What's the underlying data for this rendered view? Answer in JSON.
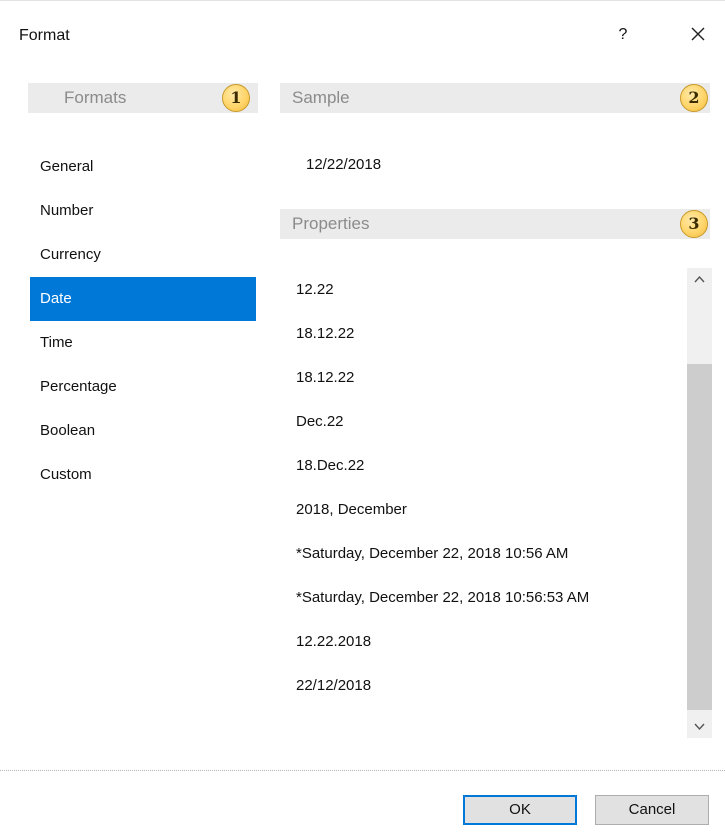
{
  "dialog": {
    "title": "Format",
    "help_label": "?",
    "close_icon": "close-icon"
  },
  "formats": {
    "header": "Formats",
    "badge": "1",
    "items": [
      {
        "label": "General"
      },
      {
        "label": "Number"
      },
      {
        "label": "Currency"
      },
      {
        "label": "Date"
      },
      {
        "label": "Time"
      },
      {
        "label": "Percentage"
      },
      {
        "label": "Boolean"
      },
      {
        "label": "Custom"
      }
    ],
    "selected": "Date"
  },
  "sample": {
    "header": "Sample",
    "badge": "2",
    "value": "12/22/2018"
  },
  "properties": {
    "header": "Properties",
    "badge": "3",
    "items": [
      {
        "label": "12.22"
      },
      {
        "label": "18.12.22"
      },
      {
        "label": "18.12.22"
      },
      {
        "label": "Dec.22"
      },
      {
        "label": "18.Dec.22"
      },
      {
        "label": "2018, December"
      },
      {
        "label": "*Saturday, December 22, 2018 10:56 AM"
      },
      {
        "label": "*Saturday, December 22, 2018 10:56:53 AM"
      },
      {
        "label": "12.22.2018"
      },
      {
        "label": "22/12/2018"
      }
    ]
  },
  "buttons": {
    "ok": "OK",
    "cancel": "Cancel"
  },
  "colors": {
    "selection": "#0078d7",
    "header_bg": "#ebebeb",
    "header_text": "#8b8b8b",
    "badge_fill": "#ffd56a"
  }
}
